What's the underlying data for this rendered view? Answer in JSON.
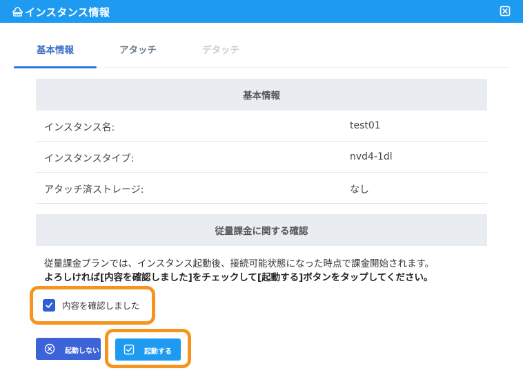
{
  "window": {
    "title": "インスタンス情報",
    "icon": "cloud-instance-icon",
    "close_icon": "close-icon"
  },
  "tabs": [
    {
      "label": "基本情報",
      "state": "active"
    },
    {
      "label": "アタッチ",
      "state": "normal"
    },
    {
      "label": "デタッチ",
      "state": "disabled"
    }
  ],
  "basic_info": {
    "heading": "基本情報",
    "rows": [
      {
        "label": "インスタンス名:",
        "value": "test01"
      },
      {
        "label": "インスタンスタイプ:",
        "value": "nvd4-1dl"
      },
      {
        "label": "アタッチ済ストレージ:",
        "value": "なし"
      }
    ]
  },
  "billing": {
    "heading": "従量課金に関する確認",
    "line1": "従量課金プランでは、インスタンス起動後、接続可能状態になった時点で課金開始されます。",
    "line2": "よろしければ[内容を確認しました]をチェックして[起動する]ボタンをタップしてください。",
    "checkbox_label": "内容を確認しました",
    "checkbox_checked": true
  },
  "buttons": {
    "cancel_label": "起動しない",
    "start_label": "起動する"
  },
  "colors": {
    "header": "#1e9bf0",
    "tab_active": "#2f6fe0",
    "button_cancel": "#3d63d9",
    "button_start": "#1e9bf0",
    "highlight": "#f7941d"
  }
}
